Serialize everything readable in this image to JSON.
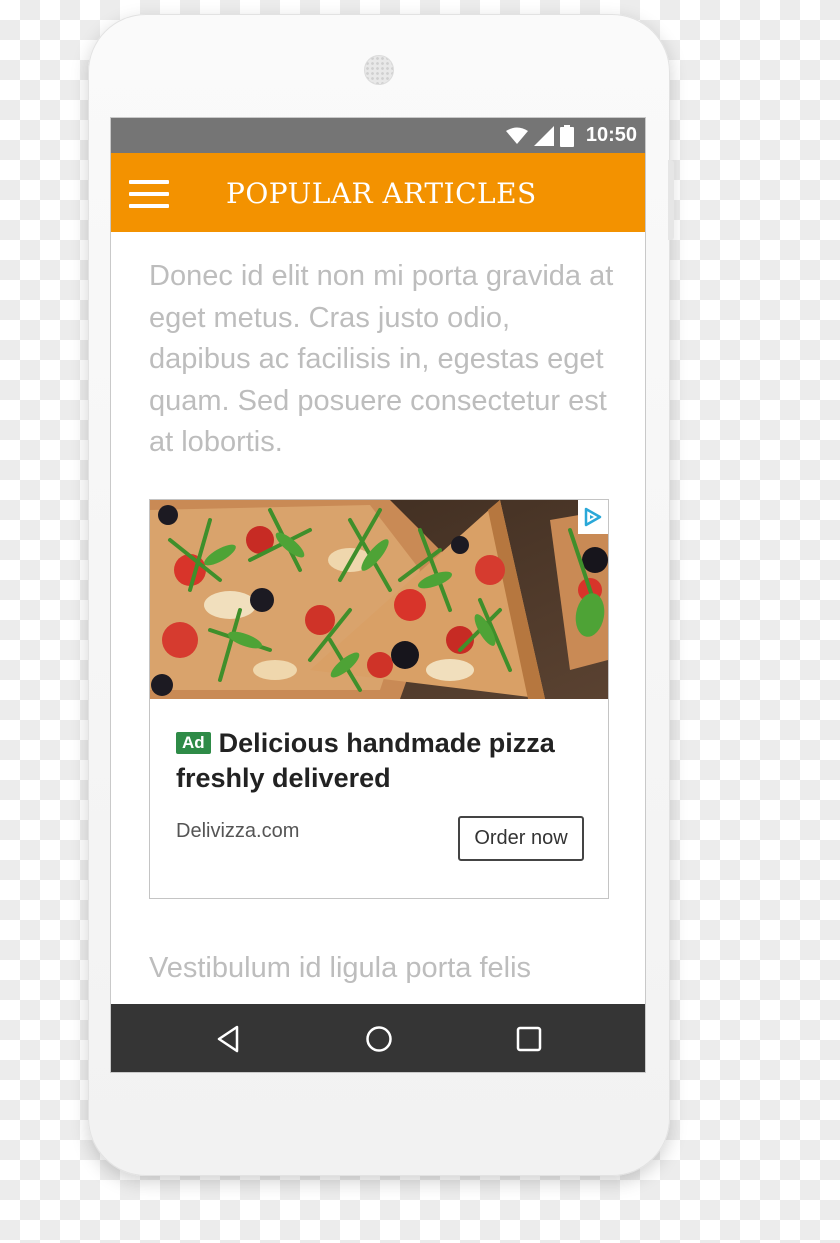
{
  "status_bar": {
    "time": "10:50",
    "icons": [
      "wifi-icon",
      "signal-icon",
      "battery-icon"
    ],
    "background": "#757575"
  },
  "app_bar": {
    "title": "POPULAR ARTICLES",
    "menu_icon": "menu-icon",
    "background": "#f39200"
  },
  "article": {
    "paragraph_1": "Donec id elit non mi porta gravida at eget metus. Cras justo odio, dapibus ac facilisis in, egestas eget quam. Sed posuere consectetur est at lobortis.",
    "paragraph_2": "Vestibulum id ligula porta felis"
  },
  "ad": {
    "badge": "Ad",
    "headline": "Delicious handmade pizza freshly delivered",
    "domain": "Delivizza.com",
    "cta_label": "Order now",
    "image": "pizza-photo",
    "choices_icon": "adchoices-icon",
    "badge_color": "#2e8b47"
  },
  "nav_bar": {
    "buttons": [
      "back-icon",
      "home-icon",
      "recents-icon"
    ],
    "background": "#353535"
  }
}
